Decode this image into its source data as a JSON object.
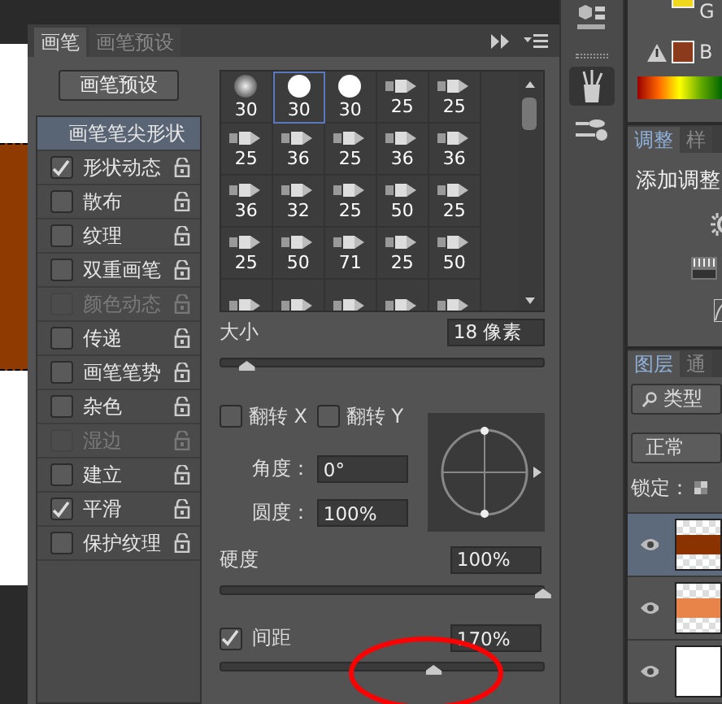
{
  "brush_panel": {
    "tabs": [
      {
        "label": "画笔",
        "selected": true
      },
      {
        "label": "画笔预设",
        "selected": false
      }
    ],
    "preset_button": "画笔预设",
    "options": [
      {
        "label": "画笔笔尖形状",
        "kind": "header",
        "selected": true
      },
      {
        "label": "形状动态",
        "kind": "option",
        "checked": true,
        "disabled": false,
        "selected": false
      },
      {
        "label": "散布",
        "kind": "option",
        "checked": false,
        "disabled": false,
        "selected": false
      },
      {
        "label": "纹理",
        "kind": "option",
        "checked": false,
        "disabled": false,
        "selected": false
      },
      {
        "label": "双重画笔",
        "kind": "option",
        "checked": false,
        "disabled": false,
        "selected": false
      },
      {
        "label": "颜色动态",
        "kind": "option",
        "checked": false,
        "disabled": true,
        "selected": false
      },
      {
        "label": "传递",
        "kind": "option",
        "checked": false,
        "disabled": false,
        "selected": false
      },
      {
        "label": "画笔笔势",
        "kind": "option",
        "checked": false,
        "disabled": false,
        "selected": false
      },
      {
        "label": "杂色",
        "kind": "option",
        "checked": false,
        "disabled": false,
        "selected": false
      },
      {
        "label": "湿边",
        "kind": "option",
        "checked": false,
        "disabled": true,
        "selected": false
      },
      {
        "label": "建立",
        "kind": "option",
        "checked": false,
        "disabled": false,
        "selected": false
      },
      {
        "label": "平滑",
        "kind": "option",
        "checked": true,
        "disabled": false,
        "selected": false
      },
      {
        "label": "保护纹理",
        "kind": "option",
        "checked": false,
        "disabled": false,
        "selected": false
      }
    ],
    "tips": [
      {
        "kind": "soft",
        "size": "30",
        "selected": false
      },
      {
        "kind": "hard",
        "size": "30",
        "selected": true
      },
      {
        "kind": "hard",
        "size": "30",
        "selected": false
      },
      {
        "kind": "brush",
        "size": "25",
        "selected": false
      },
      {
        "kind": "brush",
        "size": "25",
        "selected": false
      },
      {
        "kind": "brush",
        "size": "25",
        "selected": false
      },
      {
        "kind": "brush",
        "size": "36",
        "selected": false
      },
      {
        "kind": "brush",
        "size": "25",
        "selected": false
      },
      {
        "kind": "brush",
        "size": "36",
        "selected": false
      },
      {
        "kind": "brush",
        "size": "36",
        "selected": false
      },
      {
        "kind": "brush",
        "size": "36",
        "selected": false
      },
      {
        "kind": "brush",
        "size": "32",
        "selected": false
      },
      {
        "kind": "brush",
        "size": "25",
        "selected": false
      },
      {
        "kind": "brush",
        "size": "50",
        "selected": false
      },
      {
        "kind": "brush",
        "size": "25",
        "selected": false
      },
      {
        "kind": "brush",
        "size": "25",
        "selected": false
      },
      {
        "kind": "brush",
        "size": "50",
        "selected": false
      },
      {
        "kind": "brush",
        "size": "71",
        "selected": false
      },
      {
        "kind": "brush",
        "size": "25",
        "selected": false
      },
      {
        "kind": "brush",
        "size": "50",
        "selected": false
      },
      {
        "kind": "brush",
        "selected": false
      },
      {
        "kind": "brush",
        "selected": false
      },
      {
        "kind": "brush",
        "selected": false
      },
      {
        "kind": "brush",
        "selected": false
      },
      {
        "kind": "brush",
        "selected": false
      }
    ],
    "size": {
      "label": "大小",
      "value": "18 像素",
      "level": 0.08
    },
    "flip": [
      {
        "label": "翻转 X",
        "checked": false
      },
      {
        "label": "翻转 Y",
        "checked": false
      }
    ],
    "angle": {
      "label": "角度：",
      "value": "0°"
    },
    "roundness": {
      "label": "圆度：",
      "value": "100%"
    },
    "hardness": {
      "label": "硬度",
      "value": "100%",
      "level": 1
    },
    "spacing": {
      "label": "间距",
      "checked": true,
      "value": "170%",
      "level": 0.66
    }
  },
  "color": {
    "channels": [
      {
        "label": "G",
        "color": "#f0d81c"
      },
      {
        "label": "B",
        "color": "#8b3a1c"
      }
    ]
  },
  "adjustments": {
    "tabs": [
      {
        "label": "调整",
        "selected": true
      },
      {
        "label": "样",
        "selected": false
      }
    ],
    "title": "添加调整"
  },
  "layers": {
    "tabs": [
      {
        "label": "图层",
        "selected": true
      },
      {
        "label": "通",
        "selected": false
      }
    ],
    "filter": "类型",
    "blend_mode": "正常",
    "lock_label": "锁定：",
    "rows": [
      {
        "color": "#8b3300",
        "visible": true,
        "selected": true
      },
      {
        "color": "#e8834a",
        "visible": true,
        "selected": false
      },
      {
        "color": "#ffffff",
        "visible": true,
        "selected": false
      }
    ]
  },
  "annotations": [
    {
      "kind": "ellipse",
      "color": "#ff0000"
    }
  ]
}
